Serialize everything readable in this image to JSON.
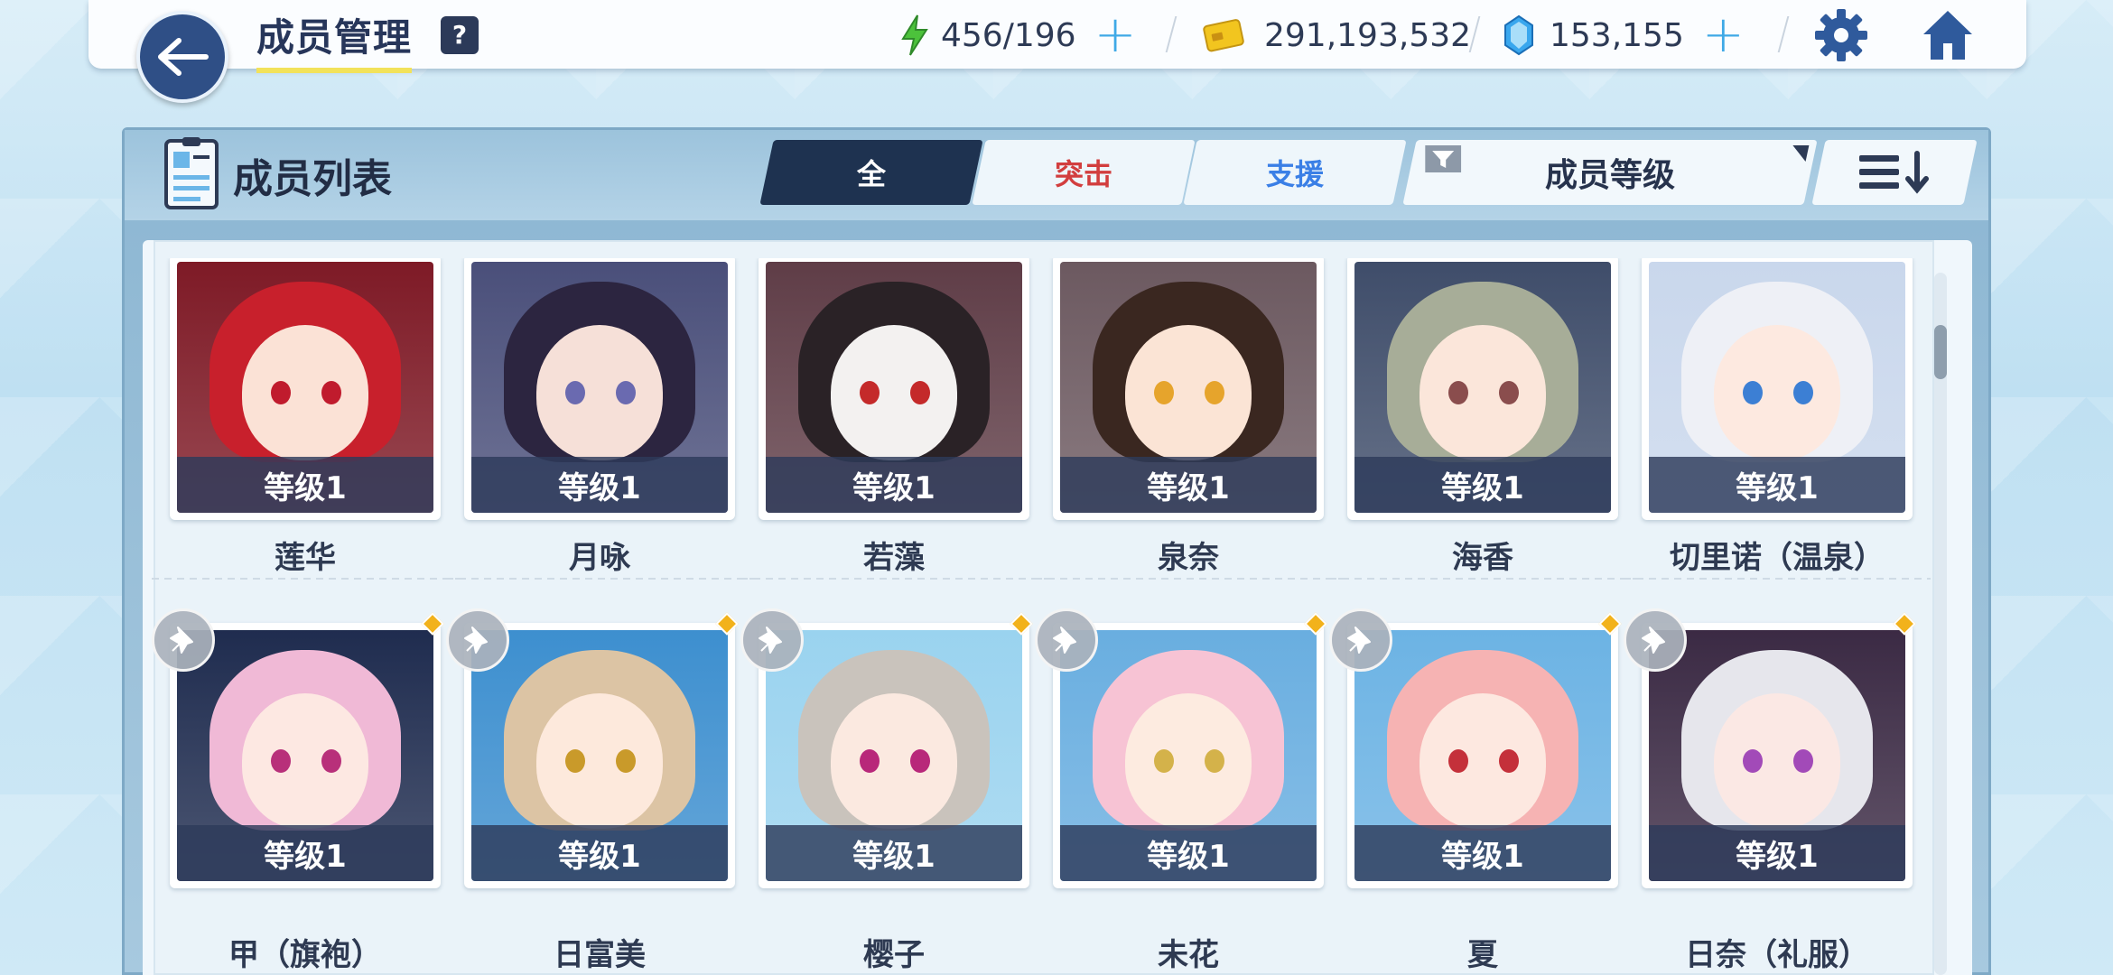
{
  "topbar": {
    "title": "成员管理",
    "help": "?",
    "ap": "456/196",
    "credits": "291,193,532",
    "pyroxene": "153,155",
    "colors": {
      "ap": "#4cc23b",
      "credit": "#f2c51f",
      "gem": "#39a7ee"
    }
  },
  "panel": {
    "title": "成员列表",
    "tabs": [
      "全",
      "突击",
      "支援"
    ],
    "sort_label": "成员等级"
  },
  "rows": [
    {
      "members": [
        {
          "name": "莲华",
          "level": "等级1",
          "hair": "#c8202c",
          "bg": "#7e1a26",
          "eye": "#c01b2d",
          "skin": "#fbe2d6"
        },
        {
          "name": "月咏",
          "level": "等级1",
          "hair": "#2c2540",
          "bg": "#4a4f7a",
          "eye": "#6a6ab0",
          "skin": "#f6e0d8"
        },
        {
          "name": "若藻",
          "level": "等级1",
          "hair": "#2a2226",
          "bg": "#5f3d47",
          "eye": "#c42a2a",
          "skin": "#f3f1f0"
        },
        {
          "name": "泉奈",
          "level": "等级1",
          "hair": "#3a2720",
          "bg": "#6c5960",
          "eye": "#e6a42c",
          "skin": "#fbe4d5"
        },
        {
          "name": "海香",
          "level": "等级1",
          "hair": "#a7ad98",
          "bg": "#3f4d6a",
          "eye": "#8a4d4d",
          "skin": "#fbe6da"
        },
        {
          "name": "切里诺（温泉）",
          "level": "等级1",
          "hair": "#eef0f6",
          "bg": "#c9d7ec",
          "eye": "#3c7fd4",
          "skin": "#fde9e0"
        }
      ]
    },
    {
      "members": [
        {
          "name": "甲（旗袍）",
          "level": "等级1",
          "hair": "#f0b9d6",
          "bg": "#1f2c4f",
          "eye": "#b8307a",
          "skin": "#fde8e2"
        },
        {
          "name": "日富美",
          "level": "等级1",
          "hair": "#dcc4a4",
          "bg": "#3d8fcf",
          "eye": "#c99a2a",
          "skin": "#fde9dc"
        },
        {
          "name": "樱子",
          "level": "等级1",
          "hair": "#c9c3bc",
          "bg": "#9ad3ef",
          "eye": "#b8287a",
          "skin": "#fbe9e0"
        },
        {
          "name": "未花",
          "level": "等级1",
          "hair": "#f7c3d4",
          "bg": "#69aee0",
          "eye": "#d4b24a",
          "skin": "#fdebe0"
        },
        {
          "name": "夏",
          "level": "等级1",
          "hair": "#f6b3b3",
          "bg": "#6cb3e4",
          "eye": "#c4303a",
          "skin": "#fde8e0"
        },
        {
          "name": "日奈（礼服）",
          "level": "等级1",
          "hair": "#e6e6ec",
          "bg": "#3b2a44",
          "eye": "#a24ab8",
          "skin": "#fbe8e4"
        }
      ]
    }
  ]
}
